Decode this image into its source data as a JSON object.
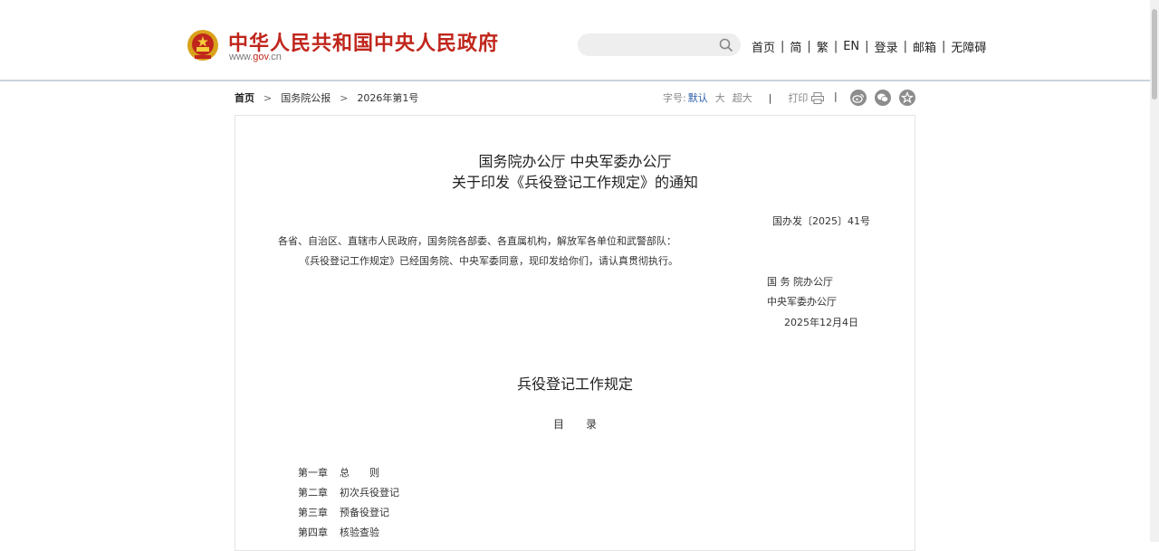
{
  "header": {
    "site_title": "中华人民共和国中央人民政府",
    "url_prefix": "www.",
    "url_domain": "gov",
    "url_suffix": ".cn",
    "search_placeholder": "",
    "nav": [
      "首页",
      "简",
      "繁",
      "EN",
      "登录",
      "邮箱",
      "无障碍"
    ],
    "separator": "|"
  },
  "breadcrumb": {
    "home": "首页",
    "items": [
      "国务院公报",
      "2026年第1号"
    ],
    "chevron": ">"
  },
  "tools": {
    "font_size_label": "字号:",
    "font_sizes": [
      "默认",
      "大",
      "超大"
    ],
    "separator": "|",
    "print_label": "打印"
  },
  "article": {
    "title_line1": "国务院办公厅  中央军委办公厅",
    "title_line2": "关于印发《兵役登记工作规定》的通知",
    "doc_number": "国办发〔2025〕41号",
    "recipients": "各省、自治区、直辖市人民政府，国务院各部委、各直属机构，解放军各单位和武警部队：",
    "body": "《兵役登记工作规定》已经国务院、中央军委同意，现印发给你们，请认真贯彻执行。",
    "signer1": "国 务 院办公厅",
    "signer2": "中央军委办公厅",
    "date": "2025年12月4日",
    "section_title": "兵役登记工作规定",
    "toc_heading": "目　　录",
    "toc": [
      {
        "chapter": "第一章",
        "name": "总　　则"
      },
      {
        "chapter": "第二章",
        "name": "初次兵役登记"
      },
      {
        "chapter": "第三章",
        "name": "预备役登记"
      },
      {
        "chapter": "第四章",
        "name": "核验查验"
      }
    ]
  },
  "colors": {
    "brand_red": "#c0261c",
    "link_blue": "#2a5ea8",
    "share_gray": "#8c8c8c"
  },
  "icons": [
    "national-emblem-icon",
    "search-icon",
    "print-icon",
    "weibo-icon",
    "wechat-icon",
    "favorite-star-icon"
  ]
}
